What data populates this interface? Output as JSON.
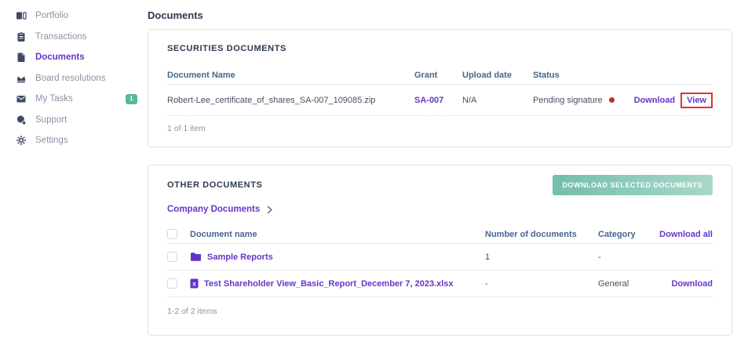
{
  "sidebar": {
    "items": [
      {
        "label": "Portfolio",
        "icon": "portfolio-icon"
      },
      {
        "label": "Transactions",
        "icon": "transactions-icon"
      },
      {
        "label": "Documents",
        "icon": "documents-icon",
        "active": true
      },
      {
        "label": "Board resolutions",
        "icon": "board-resolutions-icon"
      },
      {
        "label": "My Tasks",
        "icon": "my-tasks-icon",
        "badge": "1"
      },
      {
        "label": "Support",
        "icon": "support-icon"
      },
      {
        "label": "Settings",
        "icon": "settings-icon"
      }
    ]
  },
  "page": {
    "title": "Documents"
  },
  "securities": {
    "title": "SECURITIES DOCUMENTS",
    "columns": {
      "name": "Document Name",
      "grant": "Grant",
      "upload": "Upload date",
      "status": "Status"
    },
    "rows": [
      {
        "name": "Robert-Lee_certificate_of_shares_SA-007_109085.zip",
        "grant": "SA-007",
        "upload": "N/A",
        "status": "Pending signature",
        "download_label": "Download",
        "view_label": "View"
      }
    ],
    "footer": "1 of 1 item"
  },
  "other": {
    "title": "OTHER DOCUMENTS",
    "download_selected_label": "DOWNLOAD SELECTED DOCUMENTS",
    "breadcrumb": "Company Documents",
    "columns": {
      "name": "Document name",
      "count": "Number of documents",
      "category": "Category",
      "download_all": "Download all"
    },
    "rows": [
      {
        "name": "Sample Reports",
        "type": "folder",
        "count": "1",
        "category": "-",
        "download_label": ""
      },
      {
        "name": "Test Shareholder View_Basic_Report_December 7, 2023.xlsx",
        "type": "xlsx",
        "count": "-",
        "category": "General",
        "download_label": "Download"
      }
    ],
    "footer": "1-2 of 2 items"
  },
  "colors": {
    "accent_purple": "#6437c8",
    "badge_teal": "#57b79c",
    "button_teal": "#72bfab",
    "status_dot_red": "#c13229",
    "annotation_red": "#e8312e",
    "column_header_blue": "#44678e"
  }
}
